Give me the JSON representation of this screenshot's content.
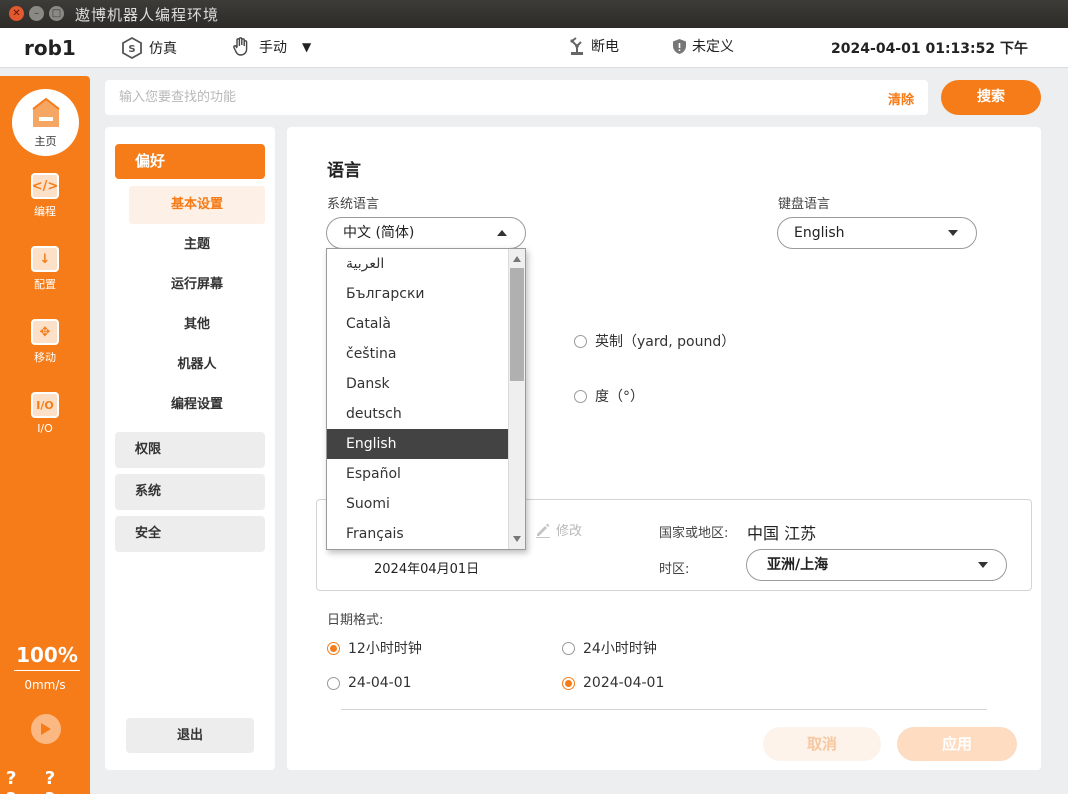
{
  "window": {
    "title": "遨博机器人编程环境"
  },
  "header": {
    "robot_name": "rob1",
    "simulation_label": "仿真",
    "mode_label": "手动",
    "power_label": "断电",
    "safety_label": "未定义",
    "datetime": "2024-04-01 01:13:52 下午"
  },
  "sidebar": {
    "home_label": "主页",
    "items": [
      {
        "label": "编程",
        "icon": "</>"
      },
      {
        "label": "配置",
        "icon": "↓"
      },
      {
        "label": "移动",
        "icon": "✥"
      },
      {
        "label": "I/O",
        "icon": "I/O"
      }
    ],
    "speed_percent": "100%",
    "speed_unit": "0mm/s",
    "help": "? ? ? ?"
  },
  "search": {
    "placeholder": "输入您要查找的功能",
    "clear_label": "清除",
    "button_label": "搜索"
  },
  "settings_nav": {
    "active_group": "偏好",
    "sub_items": [
      "基本设置",
      "主题",
      "运行屏幕",
      "其他",
      "机器人",
      "编程设置"
    ],
    "groups": [
      "权限",
      "系统",
      "安全"
    ],
    "logout_label": "退出"
  },
  "main": {
    "section_title": "语言",
    "system_language_label": "系统语言",
    "system_language_value": "中文 (简体)",
    "keyboard_language_label": "键盘语言",
    "keyboard_language_value": "English",
    "units_imperial": "英制（yard, pound）",
    "angle_degree": "度（°）",
    "edit_label": "修改",
    "date_value": "2024年04月01日",
    "country_label": "国家或地区:",
    "country_value": "中国 江苏",
    "timezone_label": "时区:",
    "timezone_value": "亚洲/上海",
    "date_format_label": "日期格式:",
    "clock_12": "12小时时钟",
    "clock_24": "24小时时钟",
    "date_short": "24-04-01",
    "date_long": "2024-04-01",
    "cancel_label": "取消",
    "apply_label": "应用"
  },
  "language_dropdown": {
    "options": [
      "العربية",
      "Български",
      "Català",
      "čeština",
      "Dansk",
      "deutsch",
      "English",
      "Español",
      "Suomi",
      "Français"
    ],
    "highlighted": "English"
  },
  "colors": {
    "accent": "#f57c18",
    "titlebar": "#2c2b28",
    "background": "#eceeef"
  }
}
